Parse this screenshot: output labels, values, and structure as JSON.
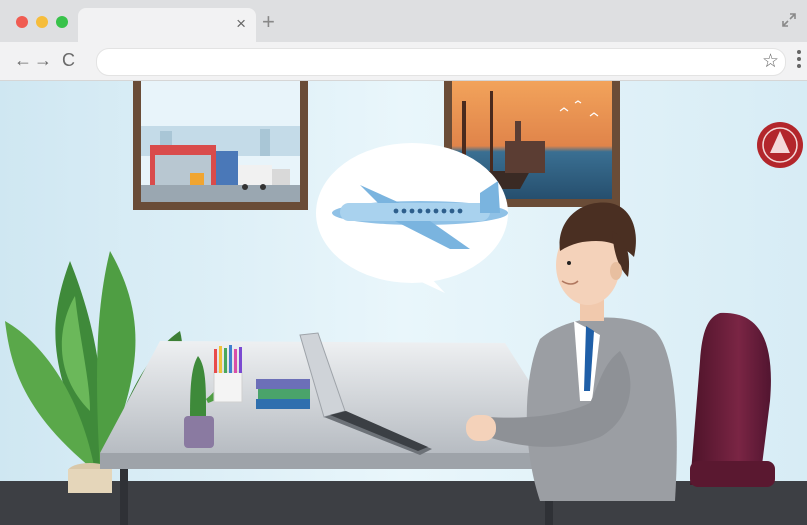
{
  "browser": {
    "tab": {
      "title": "",
      "close_glyph": "×"
    },
    "new_tab_glyph": "+",
    "nav": {
      "back_glyph": "←",
      "forward_glyph": "→",
      "reload_glyph": "C"
    },
    "address": {
      "value": "",
      "placeholder": ""
    },
    "star_glyph": "☆",
    "icons": [
      "close-icon",
      "plus-icon",
      "expand-icon",
      "back-arrow-icon",
      "forward-arrow-icon",
      "reload-icon",
      "star-icon",
      "menu-dots-icon"
    ]
  },
  "colors": {
    "close": "#f05c52",
    "minimize": "#f6bd3b",
    "maximize": "#38c24a",
    "wall": "#dff0f7",
    "desk": "#c9ccd1",
    "suit": "#9b9ea3",
    "tie": "#1f5fa8",
    "chair": "#6b1f3a",
    "logo": "#b3262b"
  },
  "scene": {
    "description_icons": [
      "warehouse-painting",
      "harbor-painting",
      "airplane-thought-bubble",
      "businessman",
      "laptop",
      "potted-plant",
      "cactus",
      "pencil-cup",
      "book-stack",
      "office-chair",
      "seal-logo"
    ]
  }
}
